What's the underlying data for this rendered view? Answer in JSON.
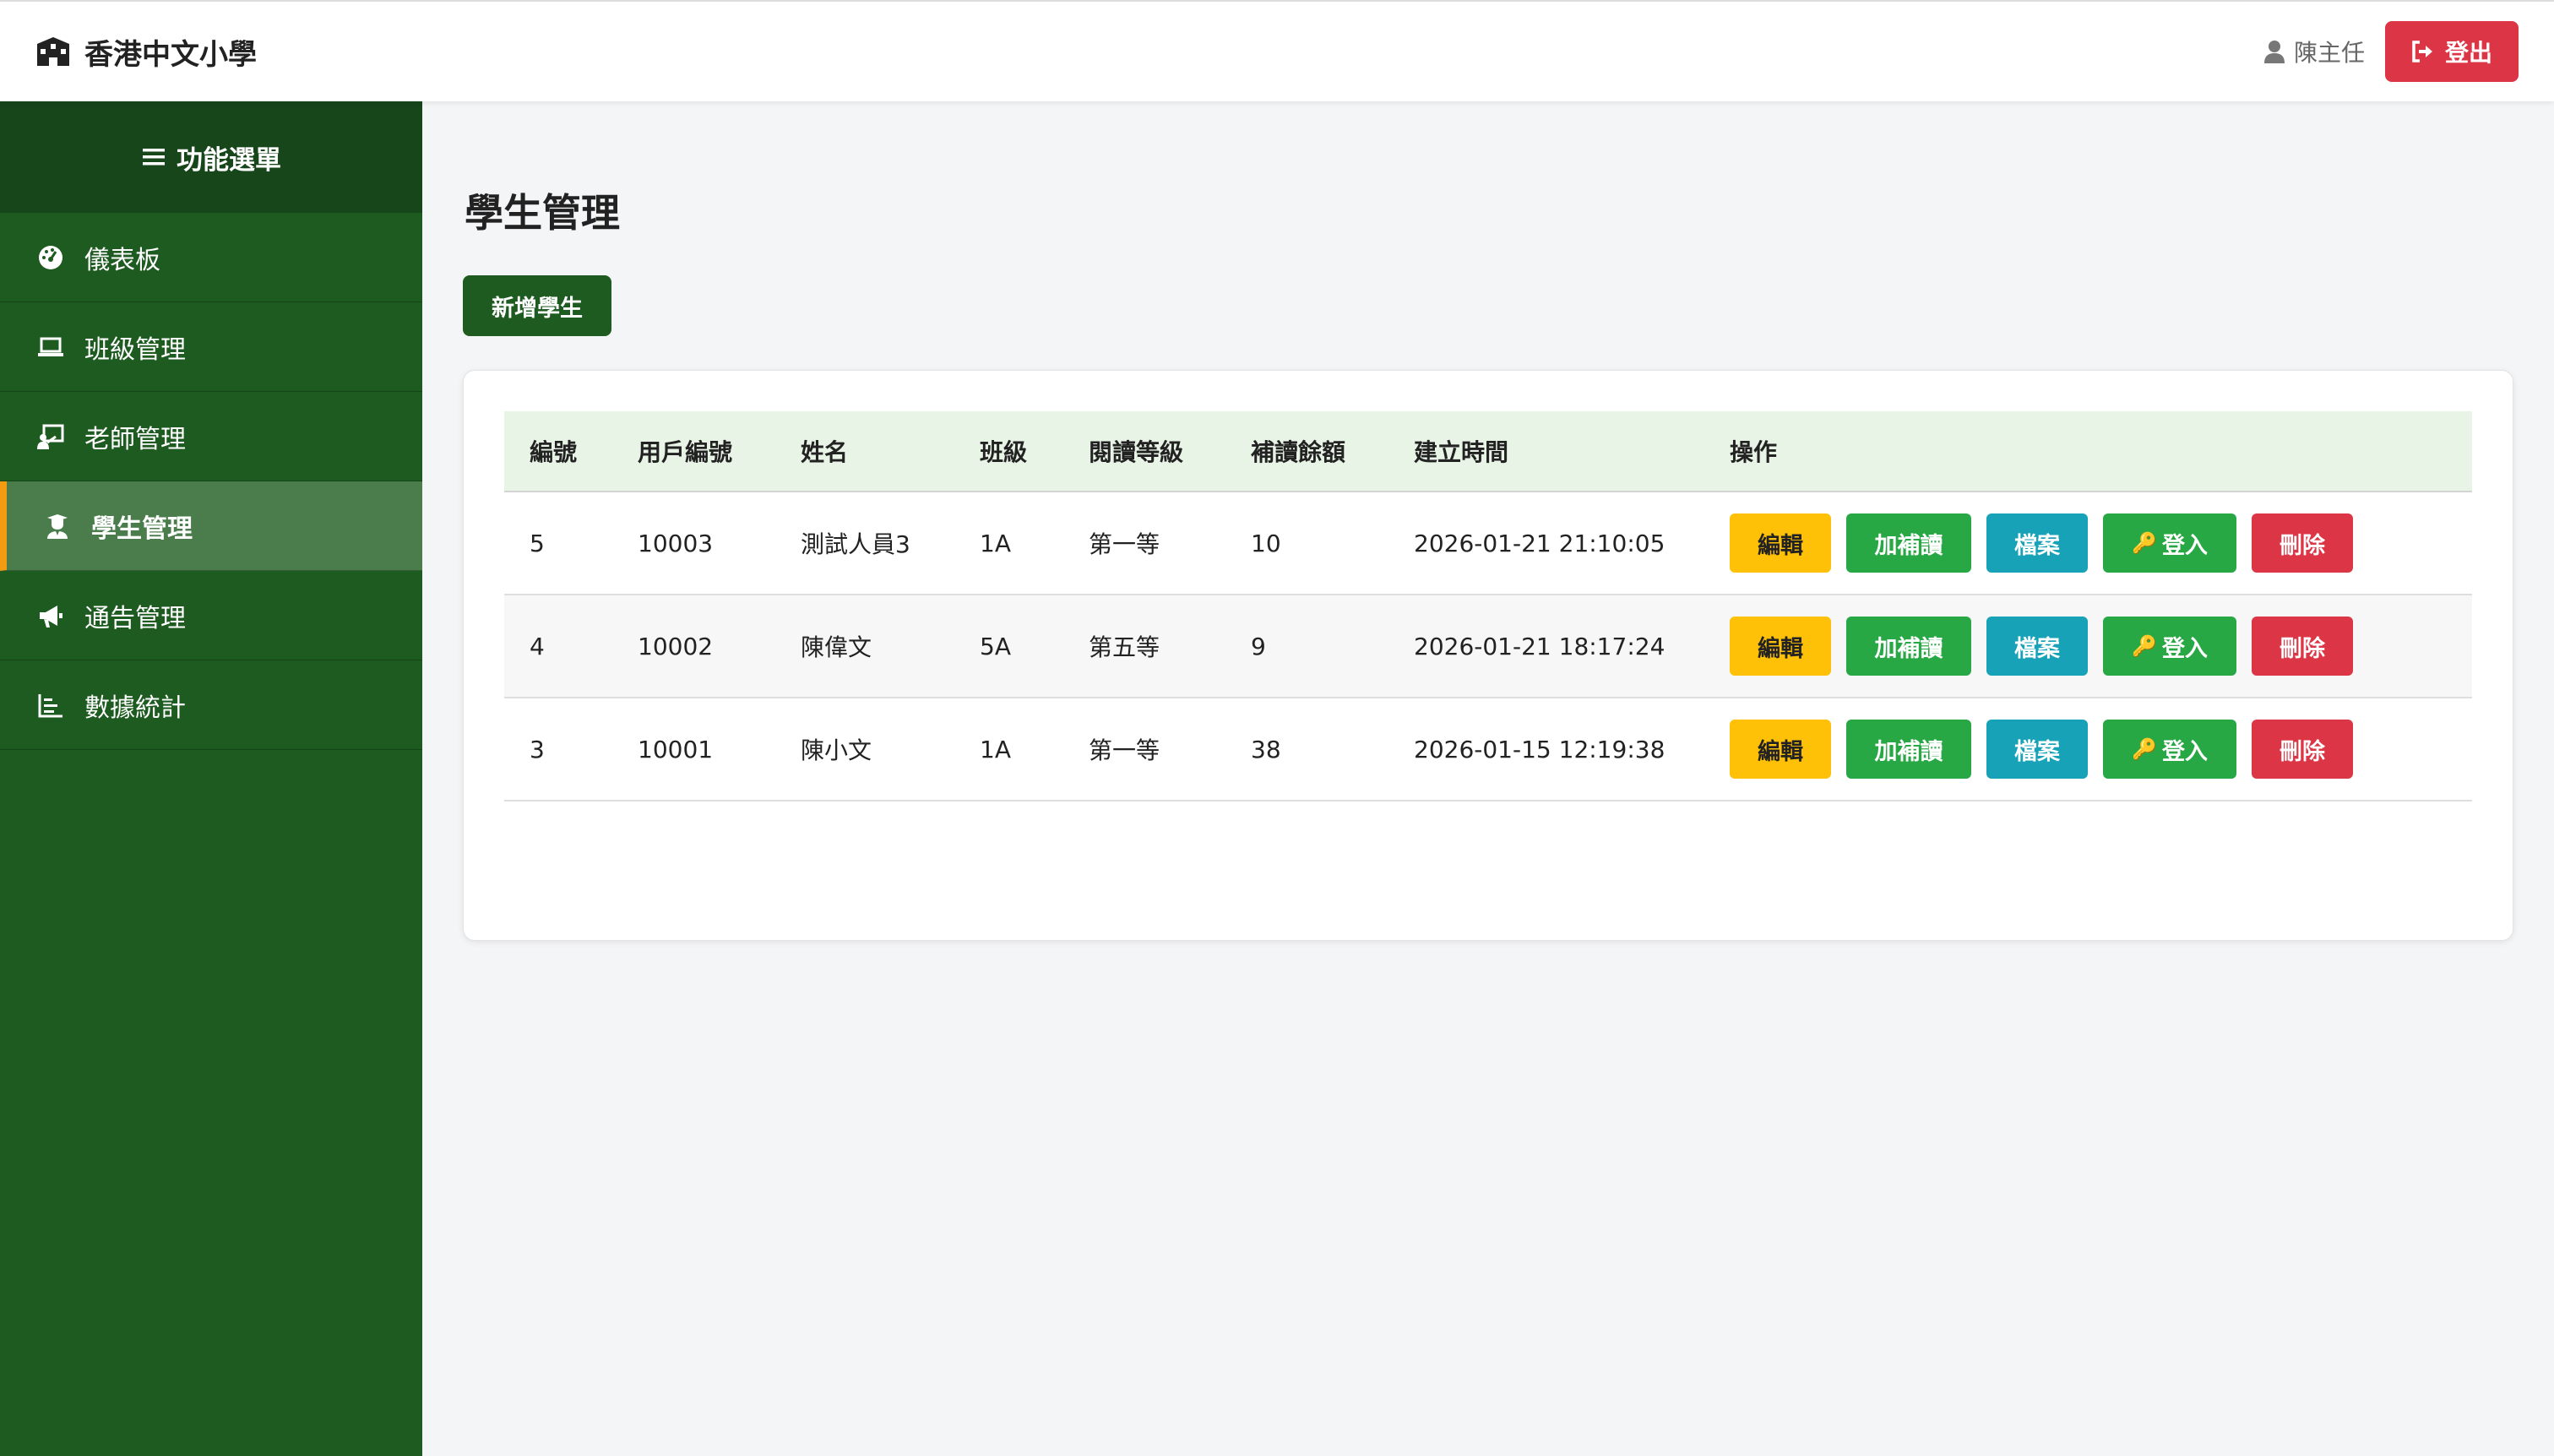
{
  "header": {
    "brand": "香港中文小學",
    "user_name": "陳主任",
    "logout_label": "登出"
  },
  "sidebar": {
    "title": "功能選單",
    "items": [
      {
        "label": "儀表板",
        "icon": "dashboard-icon"
      },
      {
        "label": "班級管理",
        "icon": "laptop-icon"
      },
      {
        "label": "老師管理",
        "icon": "teacher-icon"
      },
      {
        "label": "學生管理",
        "icon": "student-icon",
        "active": true
      },
      {
        "label": "通告管理",
        "icon": "megaphone-icon"
      },
      {
        "label": "數據統計",
        "icon": "chart-icon"
      }
    ]
  },
  "main": {
    "title": "學生管理",
    "add_label": "新增學生",
    "table": {
      "headers": [
        "編號",
        "用戶編號",
        "姓名",
        "班級",
        "閱讀等級",
        "補讀餘額",
        "建立時間",
        "操作"
      ],
      "rows": [
        {
          "id": "5",
          "uid": "10003",
          "name": "測試人員3",
          "class": "1A",
          "level": "第一等",
          "balance": "10",
          "created": "2026-01-21 21:10:05"
        },
        {
          "id": "4",
          "uid": "10002",
          "name": "陳偉文",
          "class": "5A",
          "level": "第五等",
          "balance": "9",
          "created": "2026-01-21 18:17:24"
        },
        {
          "id": "3",
          "uid": "10001",
          "name": "陳小文",
          "class": "1A",
          "level": "第一等",
          "balance": "38",
          "created": "2026-01-15 12:19:38"
        }
      ],
      "actions": {
        "edit": "編輯",
        "topup": "加補讀",
        "file": "檔案",
        "login": "登入",
        "delete": "刪除"
      }
    }
  },
  "colors": {
    "sidebar": "#1e5b20",
    "sidebar_header": "#17461a",
    "active_accent": "#f39c12",
    "danger": "#dc3545",
    "warning": "#ffc107",
    "success": "#28a745",
    "info": "#17a2b8",
    "table_header": "#e8f4e6"
  }
}
